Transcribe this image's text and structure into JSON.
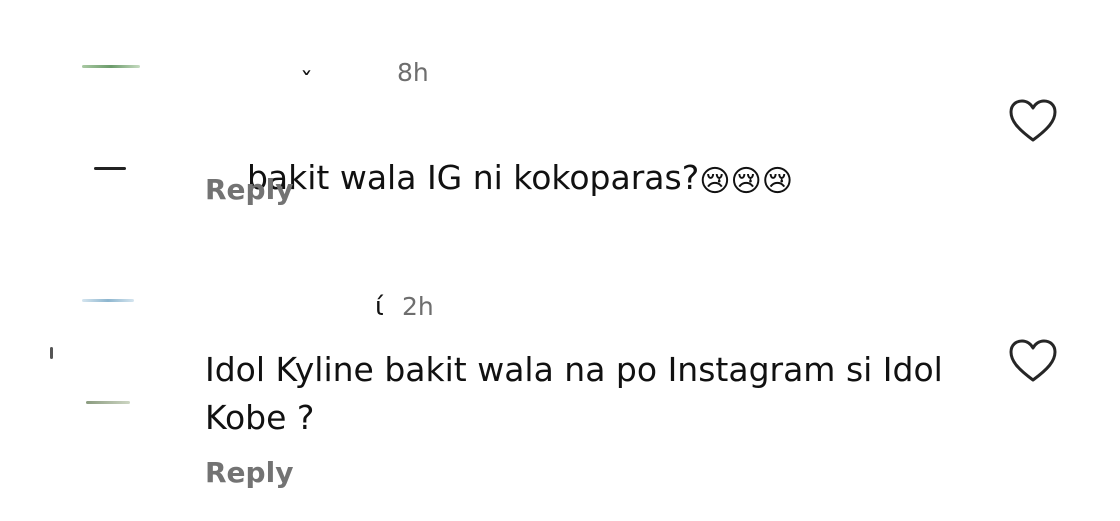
{
  "comments": [
    {
      "username_partial": "ˇ",
      "timestamp": "8h",
      "text": "bakit wala IG ni kokoparas?",
      "emojis": [
        "😢",
        "😢",
        "😢"
      ],
      "reply_label": "Reply",
      "like_icon": "heart-outline-icon"
    },
    {
      "username_partial": "ί",
      "timestamp": "2h",
      "text": "Idol Kyline bakit wala na po Instagram si Idol\nKobe ?",
      "reply_label": "Reply",
      "like_icon": "heart-outline-icon"
    }
  ],
  "colors": {
    "text": "#111111",
    "meta": "#737373",
    "background": "#ffffff"
  }
}
